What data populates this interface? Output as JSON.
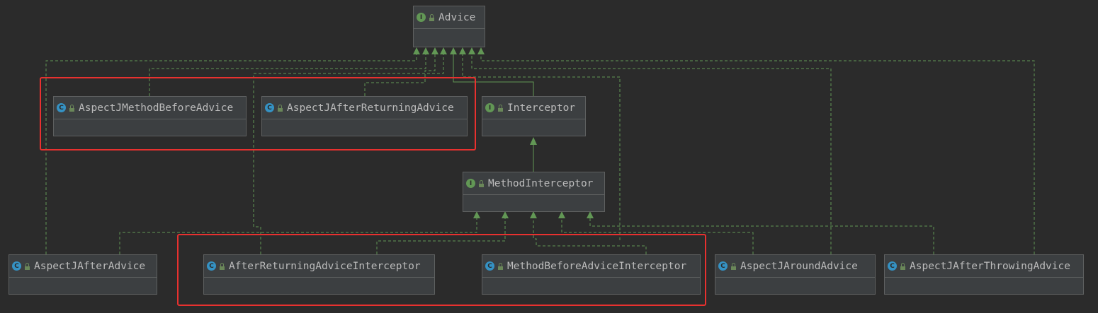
{
  "nodes": {
    "advice": {
      "name": "Advice",
      "kind": "I"
    },
    "aspectj_method_before_advice": {
      "name": "AspectJMethodBeforeAdvice",
      "kind": "C"
    },
    "aspectj_after_returning_advice": {
      "name": "AspectJAfterReturningAdvice",
      "kind": "C"
    },
    "interceptor": {
      "name": "Interceptor",
      "kind": "I"
    },
    "method_interceptor": {
      "name": "MethodInterceptor",
      "kind": "I"
    },
    "aspectj_after_advice": {
      "name": "AspectJAfterAdvice",
      "kind": "C"
    },
    "after_returning_advice_interceptor": {
      "name": "AfterReturningAdviceInterceptor",
      "kind": "C"
    },
    "method_before_advice_interceptor": {
      "name": "MethodBeforeAdviceInterceptor",
      "kind": "C"
    },
    "aspectj_around_advice": {
      "name": "AspectJAroundAdvice",
      "kind": "C"
    },
    "aspectj_after_throwing_advice": {
      "name": "AspectJAfterThrowingAdvice",
      "kind": "C"
    }
  },
  "colors": {
    "background": "#2b2b2b",
    "node_fill": "#3c3f41",
    "node_border": "#5e6060",
    "text": "#bbbbbb",
    "edge": "#629755",
    "interface_badge": "#629755",
    "class_badge": "#3592c4",
    "highlight": "#e8312f"
  },
  "icons": {
    "interface": "interface-icon",
    "class": "class-icon",
    "visibility": "unlock-icon"
  }
}
